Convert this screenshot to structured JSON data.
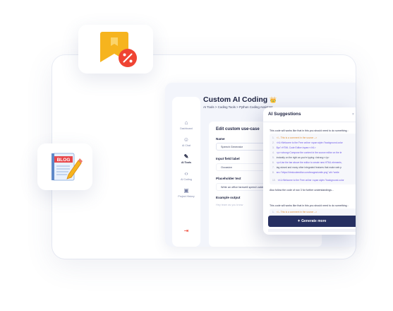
{
  "page": {
    "title": "Custom AI Coding",
    "title_emoji": "👑",
    "breadcrumb": {
      "items": [
        "AI Tools",
        "Coding Tools",
        "Python Coding Assistant"
      ],
      "separator": ">"
    }
  },
  "sidebar": {
    "items": [
      {
        "label": "Dashboard",
        "icon": "home-icon",
        "glyph": "⌂"
      },
      {
        "label": "AI Chat",
        "icon": "chat-icon",
        "glyph": "☺"
      },
      {
        "label": "AI Tools",
        "icon": "wand-icon",
        "glyph": "✎",
        "active": true
      },
      {
        "label": "AI Coding",
        "icon": "code-icon",
        "glyph": "‹›"
      },
      {
        "label": "Project History",
        "icon": "folder-icon",
        "glyph": "▣"
      }
    ],
    "logout": {
      "icon": "logout-icon",
      "glyph": "⇥"
    }
  },
  "form": {
    "title": "Edit custom use-case",
    "name_label": "Name",
    "name_value": "Speech Generator",
    "input_label": "Input field label",
    "input_value": "Occasion",
    "placeholder_label": "Placeholder text",
    "placeholder_value": "Write an office farewell speech addre",
    "example_label": "Example output",
    "example_value": "Hey team as you know"
  },
  "ai_suggestions": {
    "title": "AI Suggestions",
    "close_glyph": "×",
    "intro_1": "This code will works like that in this you should need to do something :",
    "code_1": [
      {
        "n": "1.",
        "kind": "cmt",
        "text": "<!-- This is a comment in the source -->"
      },
      {
        "n": "2.",
        "kind": "tag",
        "text": "<h1>Welcome to the Free online <span style=\"background-color"
      },
      {
        "n": "3.",
        "kind": "tag",
        "text": "$ys\">HTML Code Editor</span></h1>"
      },
      {
        "n": "4.",
        "kind": "tag",
        "text": "<p><strong>Compose the content in the source editor on the le"
      },
      {
        "n": "5.",
        "kind": "txt",
        "text": "instantly on the right as you're typing.</strong></p>"
      },
      {
        "n": "6.",
        "kind": "tag",
        "text": "<p>Use the bar above the editor to create new HTML elements,"
      },
      {
        "n": "7.",
        "kind": "txt",
        "text": "tag wizard and many other integrated features that make web p"
      },
      {
        "n": "8.",
        "kind": "tag",
        "text": "src=\"https://htmlcodeeditor.com/images/smile.png\" alt=\"smile"
      },
      {
        "n": "",
        "kind": "txt",
        "text": ""
      },
      {
        "n": "10.",
        "kind": "tag",
        "text": "<h1>Welcome to the Free online <span style=\"background-color"
      }
    ],
    "follow": "Also follow the code of row 3 for further understandings...",
    "intro_2": "This code will works like that in this you should need to do something :",
    "code_2": [
      {
        "n": "1.",
        "kind": "cmt",
        "text": "<!-- This is a comment in the source -->"
      }
    ],
    "generate_label": "Generate more",
    "generate_icon": "sparkle-icon"
  },
  "colors": {
    "accent": "#273061",
    "tag": "#6a55e6",
    "comment": "#e0913a",
    "bookmark": "#f6b41e",
    "badge": "#ef4433"
  },
  "decor": {
    "blog_label": "BLOG"
  }
}
